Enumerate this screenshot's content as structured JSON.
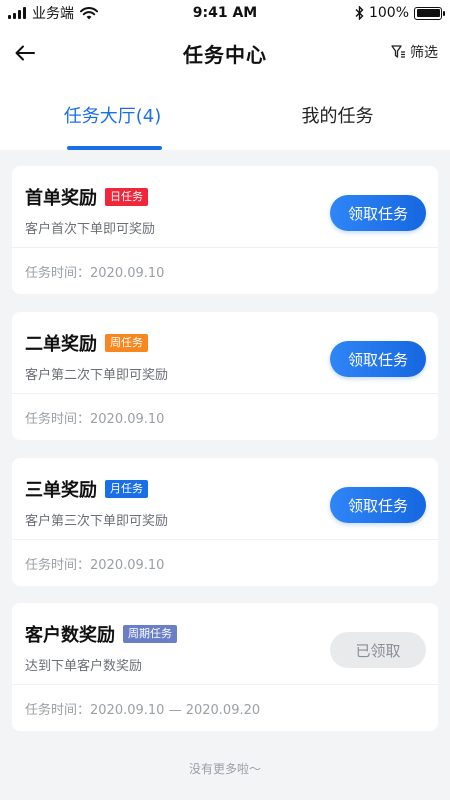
{
  "status_bar": {
    "carrier": "业务端",
    "time": "9:41 AM",
    "battery": "100%"
  },
  "nav": {
    "title": "任务中心",
    "filter_label": "筛选"
  },
  "tabs": [
    {
      "label": "任务大厅(4)",
      "active": true
    },
    {
      "label": "我的任务",
      "active": false
    }
  ],
  "tasks": [
    {
      "title": "首单奖励",
      "badge": "日任务",
      "badge_color": "#f0263a",
      "desc": "客户首次下单即可奖励",
      "time_label": "任务时间：",
      "time": "2020.09.10",
      "button": "领取任务",
      "claimed": false
    },
    {
      "title": "二单奖励",
      "badge": "周任务",
      "badge_color": "#f7871e",
      "desc": "客户第二次下单即可奖励",
      "time_label": "任务时间：",
      "time": "2020.09.10",
      "button": "领取任务",
      "claimed": false
    },
    {
      "title": "三单奖励",
      "badge": "月任务",
      "badge_color": "#1a6fe6",
      "desc": "客户第三次下单即可奖励",
      "time_label": "任务时间：",
      "time": "2020.09.10",
      "button": "领取任务",
      "claimed": false
    },
    {
      "title": "客户数奖励",
      "badge": "周期任务",
      "badge_color": "#6b7fc7",
      "desc": "达到下单客户数奖励",
      "time_label": "任务时间：",
      "time": "2020.09.10 — 2020.09.20",
      "button": "已领取",
      "claimed": true
    }
  ],
  "footer": {
    "text": "没有更多啦～"
  },
  "colors": {
    "accent": "#1a6fe6"
  }
}
